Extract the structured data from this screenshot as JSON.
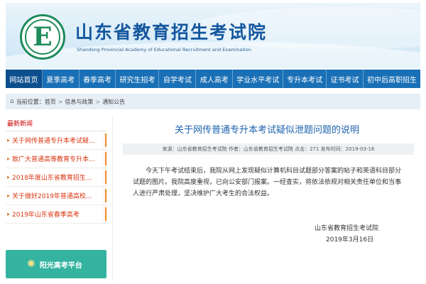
{
  "header": {
    "logo_letter": "E",
    "title": "山东省教育招生考试院",
    "subtitle": "Shandong Provincial Academy of Educational Recruitment and Examination"
  },
  "nav": {
    "items": [
      {
        "label": "网站首页",
        "active": true
      },
      {
        "label": "夏季高考"
      },
      {
        "label": "春季高考"
      },
      {
        "label": "研究生招考"
      },
      {
        "label": "自学考试"
      },
      {
        "label": "成人高考"
      },
      {
        "label": "学业水平考试"
      },
      {
        "label": "专升本考试"
      },
      {
        "label": "证书考试"
      },
      {
        "label": "初中后高职招生"
      }
    ]
  },
  "breadcrumb": {
    "prefix": "当前位置：",
    "items": [
      "首页",
      "信息与政策",
      "通知公告"
    ]
  },
  "sidebar": {
    "heading": "最新新闻",
    "items": [
      "关于网传普通专升本考试疑似泄题问题的说明",
      "致广大普通高等教育专升本考生的一封信",
      "2018年度山东省教育招生考试院",
      "关于做好2019年普通高校招生",
      "2019年山东省春季高考"
    ],
    "platform_button": "阳光高考平台"
  },
  "article": {
    "title": "关于网传普通专升本考试疑似泄题问题的说明",
    "meta": "来源：山东省教育招生考试院  作者：山东省教育招生考试院  点击：271  发布时间：2019-03-16",
    "body": "今天下午考试结束后，我院从网上发现疑似计算机科目试题部分答案的帖子和英语科目部分试题的图片。我院高度重视，已向公安部门报案。一经查实，将依法依规对相关责任单位和当事人进行严肃处理，坚决维护广大考生的合法权益。",
    "signature_org": "山东省教育招生考试院",
    "signature_date": "2019年3月16日"
  },
  "colors": {
    "nav_bg": "#1a70b6",
    "title_blue": "#14579e",
    "sidebar_red": "#d9360f",
    "platform_teal": "#34b4a0"
  }
}
